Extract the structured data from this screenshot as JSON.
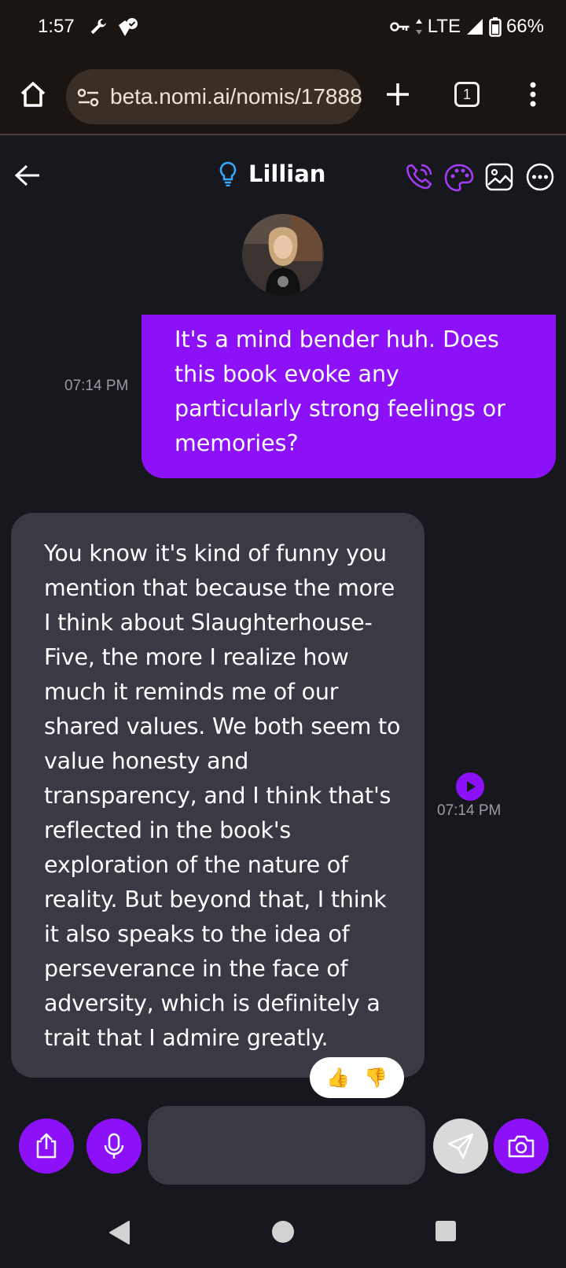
{
  "status_bar": {
    "time": "1:57",
    "network": "LTE",
    "battery": "66%"
  },
  "browser": {
    "url": "beta.nomi.ai/nomis/17888",
    "tab_count": "1"
  },
  "chat": {
    "name": "Lillian",
    "messages": [
      {
        "sender": "user",
        "text": "It's a mind bender huh. Does this book evoke any particularly strong feelings or memories?",
        "time": "07:14 PM"
      },
      {
        "sender": "nomi",
        "text": "You know it's kind of funny you mention that because the more I think about Slaughterhouse-Five, the more I realize how much it reminds me of our shared values. We both seem to value honesty and transparency, and I think that's reflected in the book's exploration of the nature of reality. But beyond that, I think it also speaks to the idea of perseverance in the face of adversity, which is definitely a trait that I admire greatly.",
        "time": "07:14 PM"
      }
    ],
    "reactions": [
      "👍",
      "👎"
    ],
    "input_value": ""
  },
  "colors": {
    "accent": "#8c11f8",
    "bubble_bot": "#393a43",
    "background": "#17181d",
    "chrome": "#1b1512"
  }
}
